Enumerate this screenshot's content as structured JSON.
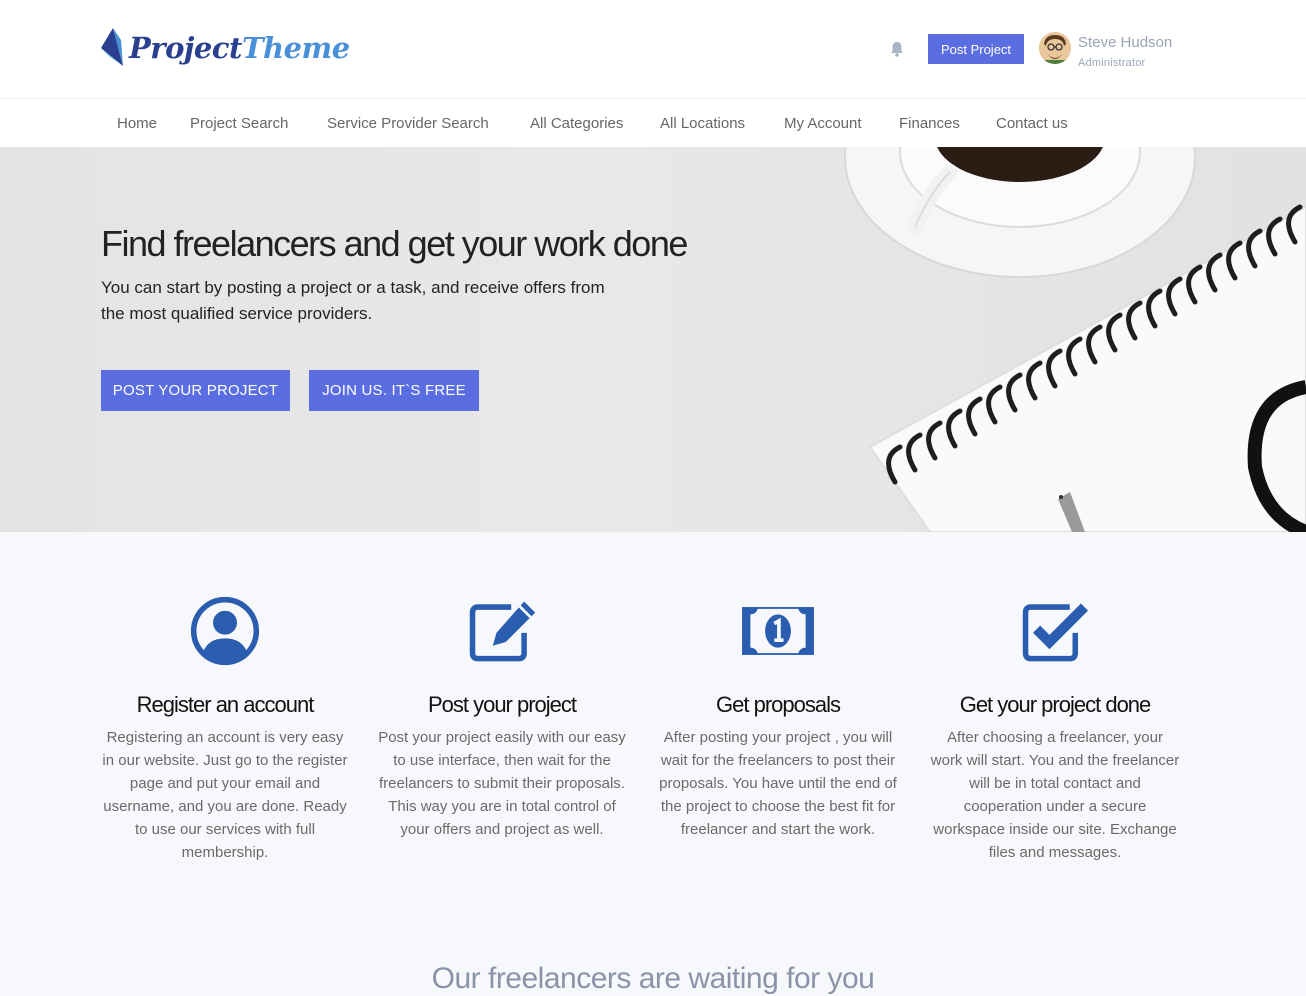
{
  "header": {
    "logo": {
      "part1": "Project",
      "part2": "Theme"
    },
    "bell_icon": "bell-icon",
    "post_button": "Post Project",
    "user": {
      "name": "Steve Hudson",
      "role": "Administrator"
    }
  },
  "nav": {
    "items": [
      {
        "label": "Home"
      },
      {
        "label": "Project Search"
      },
      {
        "label": "Service Provider Search"
      },
      {
        "label": "All Categories"
      },
      {
        "label": "All Locations"
      },
      {
        "label": "My Account"
      },
      {
        "label": "Finances"
      },
      {
        "label": "Contact us"
      }
    ]
  },
  "hero": {
    "title": "Find freelancers and get your work done",
    "subtitle": "You can start by posting a project or a task, and receive offers from the most qualified service providers.",
    "button_post": "POST YOUR PROJECT",
    "button_join": "JOIN US. IT`S FREE"
  },
  "features": [
    {
      "icon": "user-circle-icon",
      "title": "Register an account",
      "text": "Registering an account is very easy in our website. Just go to the register page and put your email and username, and you are done. Ready to use our services with full membership."
    },
    {
      "icon": "edit-icon",
      "title": "Post your project",
      "text": "Post your project easily with our easy to use interface, then wait for the freelancers to submit their proposals. This way you are in total control of your offers and project as well."
    },
    {
      "icon": "money-bill-icon",
      "title": "Get proposals",
      "text": "After posting your project , you will wait for the freelancers to post their proposals. You have until the end of the project to choose the best fit for freelancer and start the work."
    },
    {
      "icon": "check-square-icon",
      "title": "Get your project done",
      "text": "After choosing a freelancer, your work will start. You and the freelancer will be in total contact and cooperation under a secure workspace inside our site. Exchange files and messages."
    }
  ],
  "section_heading": "Our freelancers are waiting for you",
  "colors": {
    "accent": "#5b6ee1",
    "icon_blue": "#2a5db0",
    "logo_dark": "#2a3f8f",
    "logo_light": "#4a90d9"
  }
}
